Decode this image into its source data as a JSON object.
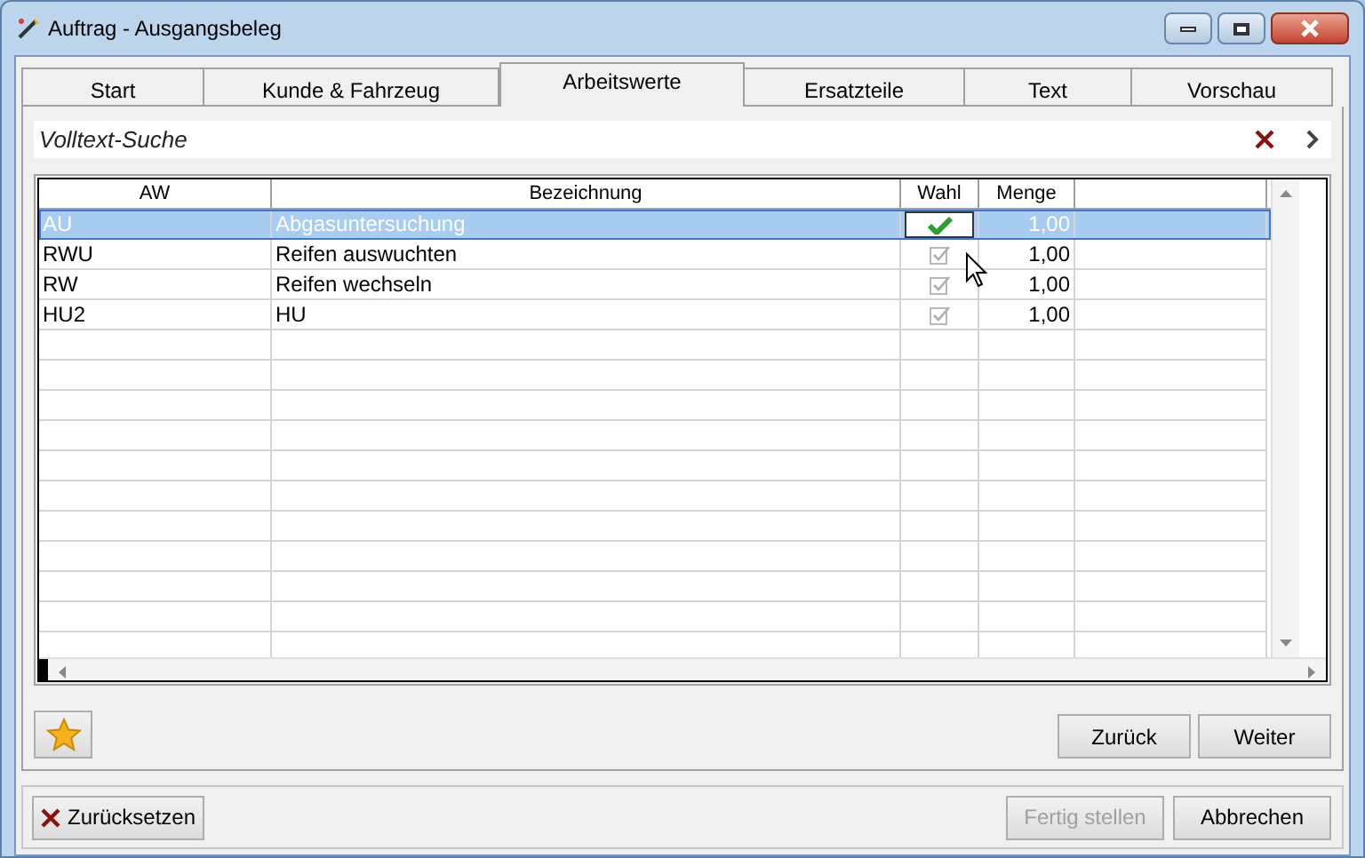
{
  "window": {
    "title": "Auftrag - Ausgangsbeleg"
  },
  "tabs": [
    {
      "label": "Start",
      "selected": false
    },
    {
      "label": "Kunde & Fahrzeug",
      "selected": false
    },
    {
      "label": "Arbeitswerte",
      "selected": true
    },
    {
      "label": "Ersatzteile",
      "selected": false
    },
    {
      "label": "Text",
      "selected": false
    },
    {
      "label": "Vorschau",
      "selected": false
    }
  ],
  "search": {
    "placeholder": "Volltext-Suche"
  },
  "table": {
    "columns": [
      "AW",
      "Bezeichnung",
      "Wahl",
      "Menge"
    ],
    "rows": [
      {
        "aw": "AU",
        "bezeichnung": "Abgasuntersuchung",
        "checked": true,
        "menge": "1,00",
        "selected": true
      },
      {
        "aw": "RWU",
        "bezeichnung": "Reifen auswuchten",
        "checked": false,
        "menge": "1,00",
        "selected": false
      },
      {
        "aw": "RW",
        "bezeichnung": "Reifen wechseln",
        "checked": false,
        "menge": "1,00",
        "selected": false
      },
      {
        "aw": "HU2",
        "bezeichnung": "HU",
        "checked": false,
        "menge": "1,00",
        "selected": false
      }
    ]
  },
  "nav_buttons": [
    {
      "label": "Zurück",
      "disabled": false
    },
    {
      "label": "Weiter",
      "disabled": false
    }
  ],
  "reset_button": {
    "label": "Zurücksetzen"
  },
  "footer_buttons": [
    {
      "label": "Fertig stellen",
      "disabled": true
    },
    {
      "label": "Abbrechen",
      "disabled": false
    }
  ]
}
